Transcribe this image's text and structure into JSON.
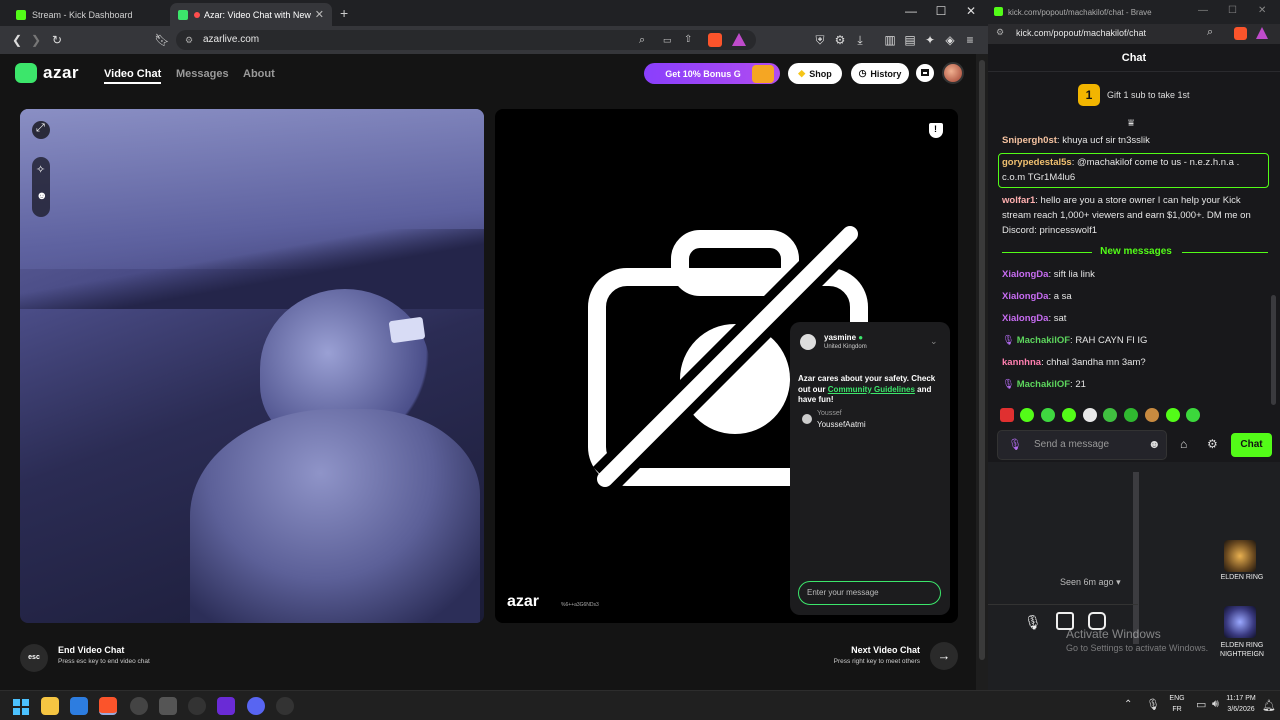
{
  "left_browser": {
    "tabs": [
      {
        "title": "Stream - Kick Dashboard"
      },
      {
        "title": "Azar: Video Chat with New Pe"
      }
    ],
    "new_tab": "+",
    "url": "azarlive.com"
  },
  "azar": {
    "logo": "azar",
    "nav": [
      "Video Chat",
      "Messages",
      "About"
    ],
    "bonus_label": "Get 10% Bonus G",
    "shop_label": "Shop",
    "history_label": "History",
    "watermark": "azar",
    "watermark_sub": "%6++a3G6NDs3",
    "end_key": "esc",
    "end_title": "End Video Chat",
    "end_hint": "Press esc key to end video chat",
    "next_title": "Next Video Chat",
    "next_hint": "Press right key to meet others",
    "chat_panel": {
      "partner_name": "yasmine",
      "partner_country": "United Kingdom",
      "safety_text_1": "Azar cares about your safety. Check out our ",
      "safety_link": "Community Guidelines",
      "safety_text_2": " and have fun!",
      "sender_name": "Youssef",
      "sender_message": "YoussefAatmi",
      "input_placeholder": "Enter your message"
    }
  },
  "right_browser": {
    "window_title": "kick.com/popout/machakilof/chat - Brave",
    "url": "kick.com/popout/machakilof/chat",
    "chat_header": "Chat",
    "gift_count": "1",
    "gift_text": "Gift 1 sub to take 1st",
    "new_messages_label": "New messages",
    "messages": [
      {
        "user": "Snipergh0st",
        "color": "#f5c2a0",
        "text": "khuya ucf sir tn3sslik"
      },
      {
        "user": "gorypedestal5s",
        "color": "#f0c070",
        "text": "@machakilof come to us - n.e.z.h.n.a . c.o.m TGr1M4lu6"
      },
      {
        "user": "wolfar1",
        "color": "#ffb0b0",
        "text": "hello are you a store owner I can help your Kick stream reach 1,000+ viewers and earn $1,000+. DM me on Discord: princesswolf1"
      },
      {
        "user": "XialongDa",
        "color": "#c76cf2",
        "text": "sift lia link"
      },
      {
        "user": "XialongDa",
        "color": "#c76cf2",
        "text": "a sa"
      },
      {
        "user": "XialongDa",
        "color": "#c76cf2",
        "text": "sat"
      },
      {
        "user": "MachakilOF",
        "color": "#5dd55d",
        "text": "RAH CAYN FI IG"
      },
      {
        "user": "kannhna",
        "color": "#ff7fb0",
        "text": "chhal 3andha mn 3am?"
      },
      {
        "user": "MachakilOF",
        "color": "#5dd55d",
        "text": "21"
      }
    ],
    "send_placeholder": "Send a message",
    "chat_button": "Chat"
  },
  "desktop": {
    "seen_text": "Seen 6m ago",
    "activate_title": "Activate Windows",
    "activate_sub": "Go to Settings to activate Windows.",
    "icons": [
      {
        "label": "ELDEN RING"
      },
      {
        "label": "ELDEN RING NIGHTREIGN"
      }
    ]
  },
  "taskbar": {
    "lang_top": "ENG",
    "lang_bottom": "FR",
    "time": "11:17 PM",
    "date": "3/6/2026"
  },
  "colors": {
    "kick_green": "#53fc18",
    "azar_purple": "#8a3ffc",
    "azar_green": "#3ce66b"
  }
}
